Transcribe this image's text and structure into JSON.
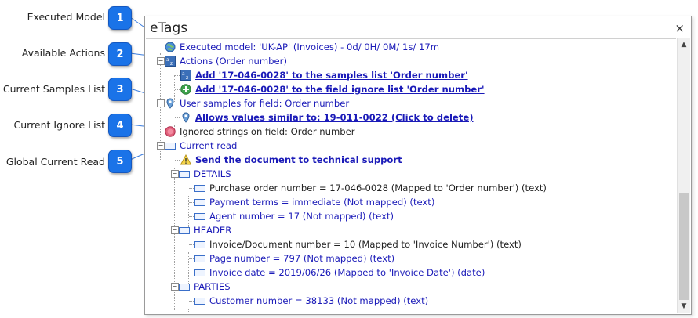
{
  "callouts": [
    {
      "number": "1",
      "label": "Executed Model"
    },
    {
      "number": "2",
      "label": "Available Actions"
    },
    {
      "number": "3",
      "label": "Current Samples List"
    },
    {
      "number": "4",
      "label": "Current Ignore List"
    },
    {
      "number": "5",
      "label": "Global Current Read"
    }
  ],
  "panel": {
    "title": "eTags",
    "close_icon": "×"
  },
  "tree": {
    "executed_model": "Executed model: 'UK-AP' (Invoices)  -  0d/ 0H/ 0M/ 1s/ 17m",
    "actions": "Actions (Order number)",
    "action_add_samples": "Add '17-046-0028' to the samples list 'Order number'",
    "action_add_ignore": "Add '17-046-0028' to the field ignore list 'Order number'",
    "user_samples": "User samples for field: Order number",
    "allows_values": "Allows values similar to: 19-011-0022 (Click to delete)",
    "ignored_strings": "Ignored strings on field: Order number",
    "current_read": "Current read",
    "send_document": "Send the document to technical support",
    "details": "DETAILS",
    "purchase_order": "Purchase order number = 17-046-0028 (Mapped to 'Order number') (text)",
    "payment_terms": "Payment terms = immediate (Not mapped) (text)",
    "agent_number": "Agent number = 17 (Not mapped) (text)",
    "header": "HEADER",
    "invoice_document": "Invoice/Document number = 10 (Mapped to 'Invoice Number') (text)",
    "page_number": "Page number = 797 (Not mapped) (text)",
    "invoice_date": "Invoice date = 2019/06/26 (Mapped to 'Invoice Date') (date)",
    "parties": "PARTIES",
    "customer_number": "Customer number = 38133 (Not mapped) (text)"
  },
  "scrollbar": {
    "up_arrow": "▲",
    "down_arrow": "▼"
  },
  "colors": {
    "badge": "#1a73e8",
    "tree_text": "#1a1ab8",
    "link": "#1a1ab8"
  }
}
